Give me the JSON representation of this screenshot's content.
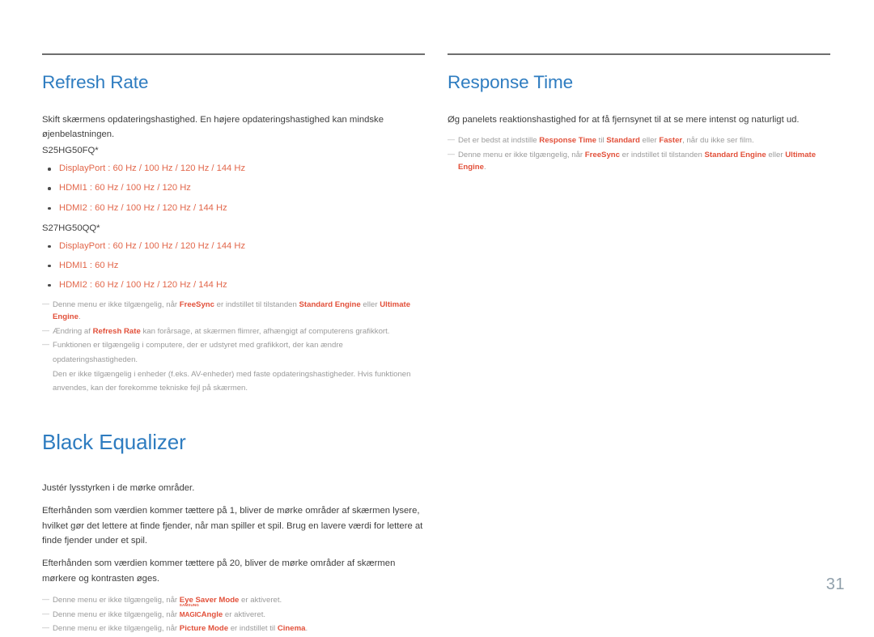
{
  "document": {
    "page_number": "31",
    "accent_heading_color": "#2e7cc0",
    "highlight_color": "#e2503a",
    "bullet_text_color": "#e2674b",
    "note_text_color": "#9b9b9b"
  },
  "left_column": {
    "refresh_rate": {
      "title": "Refresh Rate",
      "intro": "Skift skærmens opdateringshastighed. En højere opdateringshastighed kan mindske øjenbelastningen.",
      "model_1": "S25HG50FQ*",
      "model_1_options": [
        "DisplayPort : 60 Hz / 100 Hz / 120 Hz / 144 Hz",
        "HDMI1 : 60 Hz / 100 Hz / 120 Hz",
        "HDMI2 : 60 Hz / 100 Hz / 120 Hz / 144 Hz"
      ],
      "model_2": "S27HG50QQ*",
      "model_2_options": [
        "DisplayPort : 60 Hz / 100 Hz / 120 Hz / 144 Hz",
        "HDMI1 : 60 Hz",
        "HDMI2 : 60 Hz / 100 Hz / 120 Hz / 144 Hz"
      ],
      "note_1": {
        "part_1": "Denne menu er ikke tilgængelig, når ",
        "hl_1": "FreeSync",
        "part_2": " er indstillet til tilstanden ",
        "hl_2": "Standard Engine",
        "part_3": " eller ",
        "hl_3": "Ultimate Engine",
        "part_4": "."
      },
      "note_2": {
        "part_1": "Ændring af ",
        "hl_1": "Refresh Rate",
        "part_2": " kan forårsage, at skærmen flimrer, afhængigt af computerens grafikkort."
      },
      "note_3_line_1": "Funktionen er tilgængelig i computere, der er udstyret med grafikkort, der kan ændre",
      "note_3_line_2": "opdateringshastigheden.",
      "note_3_line_3": "Den er ikke tilgængelig i enheder (f.eks. AV-enheder) med faste opdateringshastigheder. Hvis funktionen",
      "note_3_line_4": "anvendes, kan der forekomme tekniske fejl på skærmen."
    },
    "black_equalizer": {
      "title": "Black Equalizer",
      "para_1": "Justér lysstyrken i de mørke områder.",
      "para_2": "Efterhånden som værdien kommer tættere på 1, bliver de mørke områder af skærmen lysere, hvilket gør det lettere at finde fjender, når man spiller et spil. Brug en lavere værdi for lettere at finde fjender under et spil.",
      "para_3": "Efterhånden som værdien kommer tættere på 20, bliver de mørke områder af skærmen mørkere og kontrasten øges.",
      "note_1": {
        "part_1": "Denne menu er ikke tilgængelig, når ",
        "hl_1": "Eye Saver Mode",
        "part_2": " er aktiveret."
      },
      "note_2": {
        "part_1": "Denne menu er ikke tilgængelig, når ",
        "logo_samsung": "SAMSUNG",
        "logo_magic": "MAGIC",
        "logo_angle": "Angle",
        "part_2": " er aktiveret."
      },
      "note_3": {
        "part_1": "Denne menu er ikke tilgængelig, når ",
        "hl_1": "Picture Mode",
        "part_2": " er indstillet til ",
        "hl_2": "Cinema",
        "part_3": "."
      }
    }
  },
  "right_column": {
    "response_time": {
      "title": "Response Time",
      "intro": "Øg panelets reaktionshastighed for at få fjernsynet til at se mere intenst og naturligt ud.",
      "note_1": {
        "part_1": "Det er bedst at indstille ",
        "hl_1": "Response Time",
        "part_2": " til ",
        "hl_2": "Standard",
        "part_3": " eller ",
        "hl_3": "Faster",
        "part_4": ", når du ikke ser film."
      },
      "note_2": {
        "part_1": "Denne menu er ikke tilgængelig, når ",
        "hl_1": "FreeSync",
        "part_2": " er indstillet til tilstanden ",
        "hl_2": "Standard Engine",
        "part_3": " eller ",
        "hl_3": "Ultimate Engine",
        "part_4": "."
      }
    }
  }
}
